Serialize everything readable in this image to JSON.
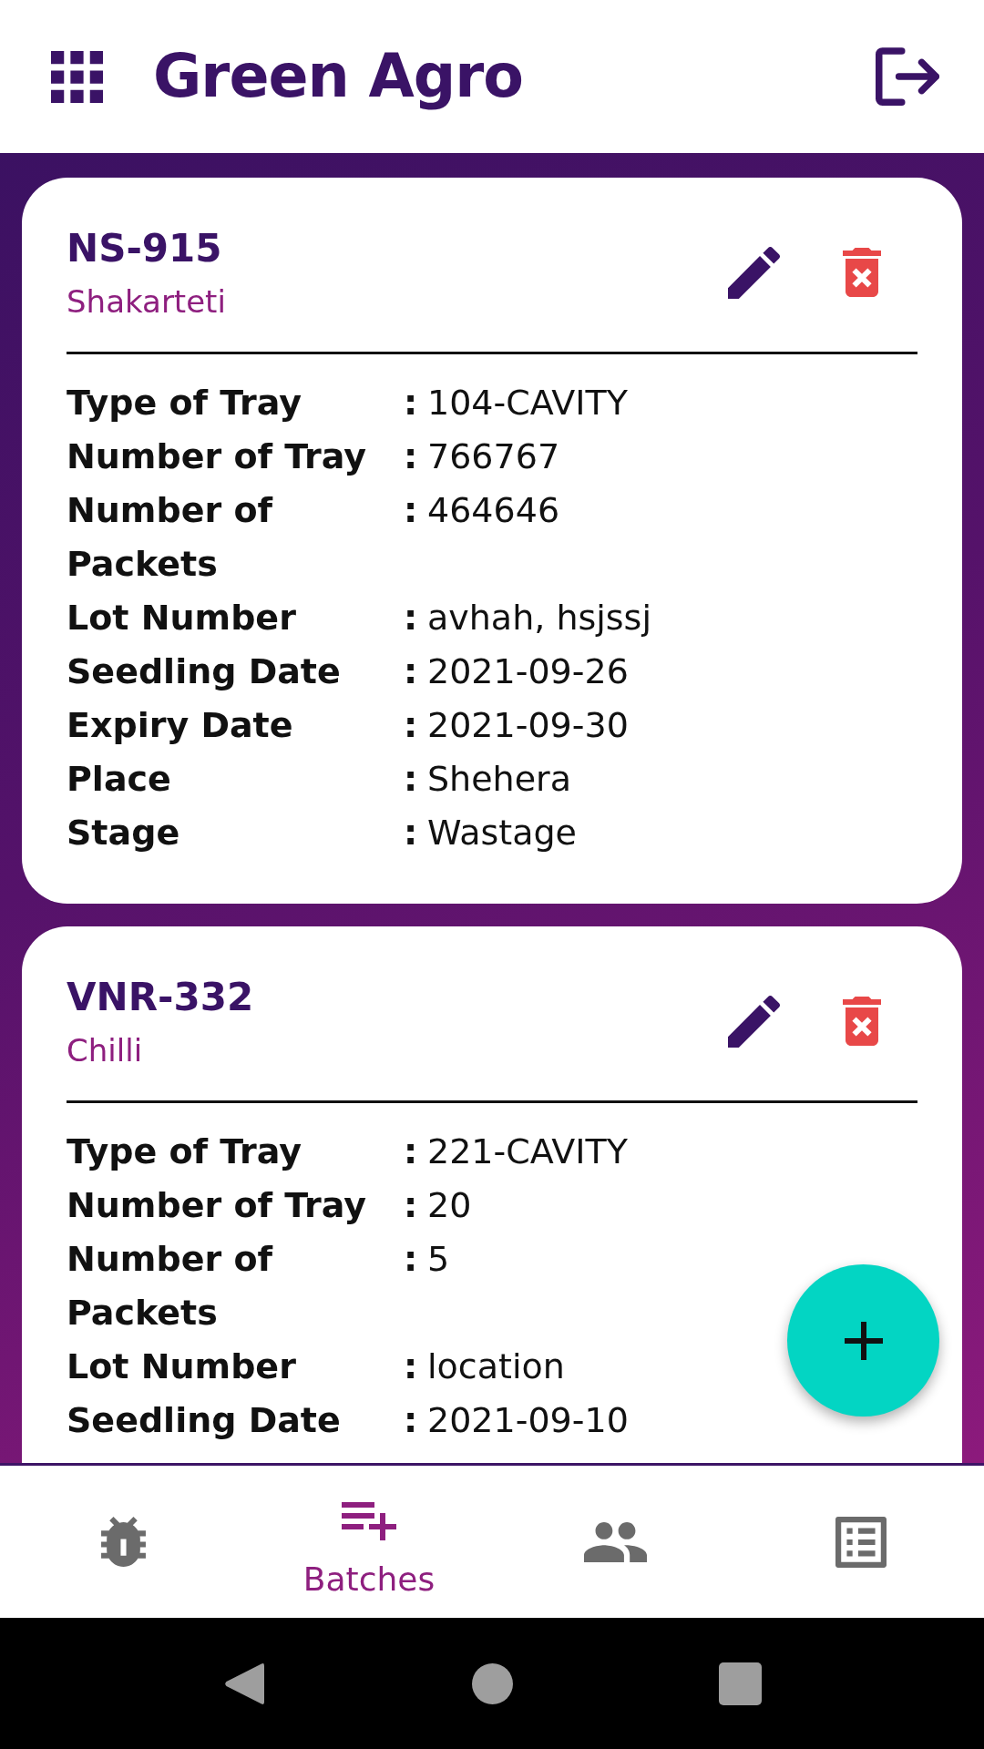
{
  "app_bar": {
    "title": "Green Agro"
  },
  "batches": [
    {
      "code": "NS-915",
      "crop": "Shakarteti",
      "fields": [
        {
          "label": "Type of Tray",
          "separator": ":",
          "value": "104-CAVITY"
        },
        {
          "label": "Number of Tray",
          "separator": ":",
          "value": "766767"
        },
        {
          "label": "Number of Packets",
          "separator": ":",
          "value": "464646"
        },
        {
          "label": "Lot Number",
          "separator": ":",
          "value": "avhah, hsjssj"
        },
        {
          "label": "Seedling Date",
          "separator": ":",
          "value": "2021-09-26"
        },
        {
          "label": "Expiry Date",
          "separator": ":",
          "value": "2021-09-30"
        },
        {
          "label": "Place",
          "separator": ":",
          "value": "Shehera"
        },
        {
          "label": "Stage",
          "separator": ":",
          "value": "Wastage"
        }
      ]
    },
    {
      "code": "VNR-332",
      "crop": "Chilli",
      "fields": [
        {
          "label": "Type of Tray",
          "separator": ":",
          "value": "221-CAVITY"
        },
        {
          "label": "Number of Tray",
          "separator": ":",
          "value": "20"
        },
        {
          "label": "Number of Packets",
          "separator": ":",
          "value": "5"
        },
        {
          "label": "Lot Number",
          "separator": ":",
          "value": "location"
        },
        {
          "label": "Seedling Date",
          "separator": ":",
          "value": "2021-09-10"
        }
      ]
    }
  ],
  "bottom_nav": [
    {
      "kind": "bug",
      "selected": false
    },
    {
      "kind": "batches",
      "label": "Batches",
      "selected": true
    },
    {
      "kind": "people",
      "selected": false
    },
    {
      "kind": "list",
      "selected": false
    }
  ]
}
